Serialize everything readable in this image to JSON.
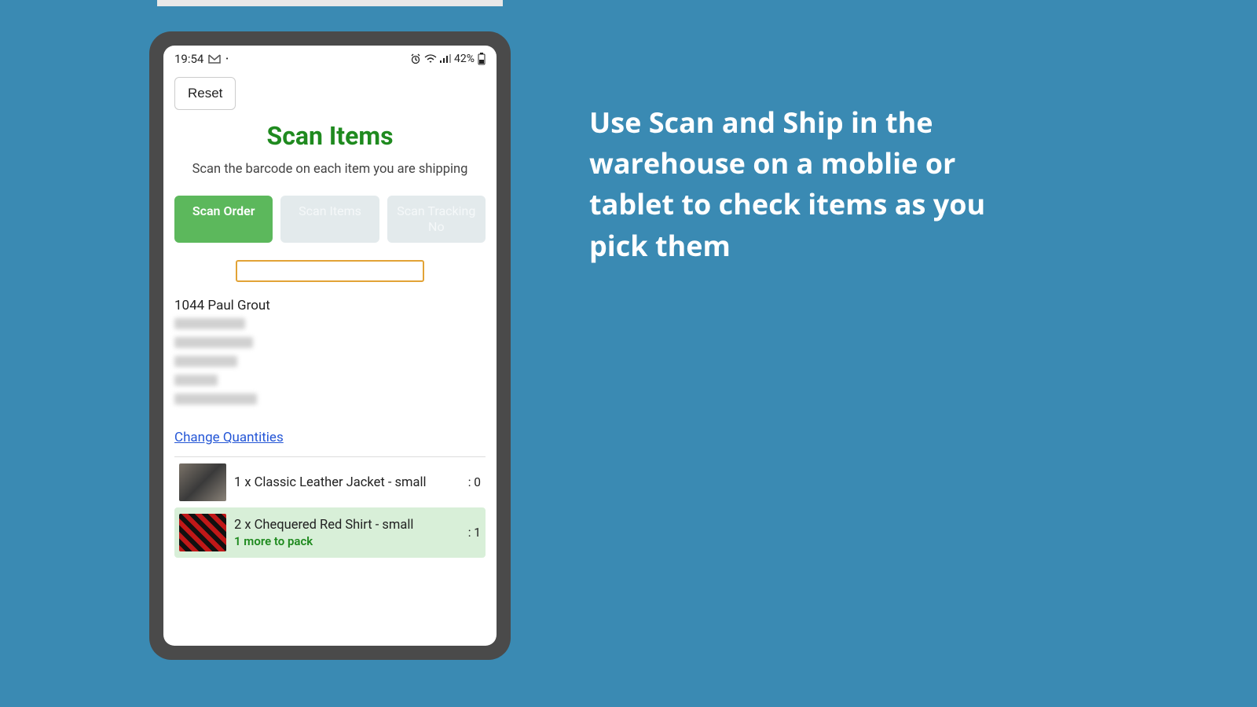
{
  "promo": {
    "text": "Use Scan and Ship in the warehouse on a moblie or tablet to check items as you pick them"
  },
  "statusbar": {
    "time": "19:54",
    "battery_text": "42%"
  },
  "app": {
    "reset_label": "Reset",
    "title": "Scan Items",
    "subtitle": "Scan the barcode on each item you are shipping",
    "tabs": {
      "scan_order": "Scan Order",
      "scan_items": "Scan Items",
      "scan_tracking": "Scan Tracking No"
    },
    "order_id": "1044 Paul Grout",
    "change_quantities_label": "Change Quantities",
    "items": [
      {
        "label": "1 x Classic Leather Jacket - small",
        "count": ": 0",
        "sub": ""
      },
      {
        "label": "2 x Chequered Red Shirt - small",
        "count": ": 1",
        "sub": "1 more to pack"
      }
    ]
  }
}
